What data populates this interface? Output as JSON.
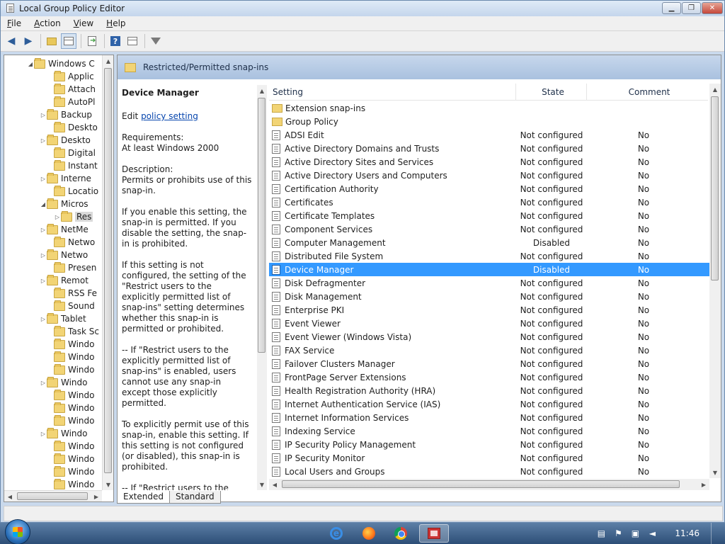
{
  "window": {
    "title": "Local Group Policy Editor",
    "minimize": "▁",
    "maximize": "❐",
    "close": "✕"
  },
  "menu": [
    {
      "key": "F",
      "rest": "ile"
    },
    {
      "key": "A",
      "rest": "ction"
    },
    {
      "key": "V",
      "rest": "iew"
    },
    {
      "key": "H",
      "rest": "elp"
    }
  ],
  "toolbar": {
    "back": "◀",
    "forward": "▶",
    "help": "?"
  },
  "tree": {
    "items": [
      {
        "label": "Windows C",
        "arrow": "◢",
        "indent": 46
      },
      {
        "label": "Applic",
        "arrow": "",
        "indent": 74
      },
      {
        "label": "Attach",
        "arrow": "",
        "indent": 74
      },
      {
        "label": "AutoPl",
        "arrow": "",
        "indent": 74
      },
      {
        "label": "Backup",
        "arrow": "▷",
        "indent": 64
      },
      {
        "label": "Deskto",
        "arrow": "",
        "indent": 74
      },
      {
        "label": "Deskto",
        "arrow": "▷",
        "indent": 64
      },
      {
        "label": "Digital",
        "arrow": "",
        "indent": 74
      },
      {
        "label": "Instant",
        "arrow": "",
        "indent": 74
      },
      {
        "label": "Interne",
        "arrow": "▷",
        "indent": 64
      },
      {
        "label": "Locatio",
        "arrow": "",
        "indent": 74
      },
      {
        "label": "Micros",
        "arrow": "◢",
        "indent": 64
      },
      {
        "label": "Res",
        "arrow": "▷",
        "indent": 84,
        "selected": true
      },
      {
        "label": "NetMe",
        "arrow": "▷",
        "indent": 64
      },
      {
        "label": "Netwo",
        "arrow": "",
        "indent": 74
      },
      {
        "label": "Netwo",
        "arrow": "▷",
        "indent": 64
      },
      {
        "label": "Presen",
        "arrow": "",
        "indent": 74
      },
      {
        "label": "Remot",
        "arrow": "▷",
        "indent": 64
      },
      {
        "label": "RSS Fe",
        "arrow": "",
        "indent": 74
      },
      {
        "label": "Sound",
        "arrow": "",
        "indent": 74
      },
      {
        "label": "Tablet",
        "arrow": "▷",
        "indent": 64
      },
      {
        "label": "Task Sc",
        "arrow": "",
        "indent": 74
      },
      {
        "label": "Windo",
        "arrow": "",
        "indent": 74
      },
      {
        "label": "Windo",
        "arrow": "",
        "indent": 74
      },
      {
        "label": "Windo",
        "arrow": "",
        "indent": 74
      },
      {
        "label": "Windo",
        "arrow": "▷",
        "indent": 64
      },
      {
        "label": "Windo",
        "arrow": "",
        "indent": 74
      },
      {
        "label": "Windo",
        "arrow": "",
        "indent": 74
      },
      {
        "label": "Windo",
        "arrow": "",
        "indent": 74
      },
      {
        "label": "Windo",
        "arrow": "▷",
        "indent": 64
      },
      {
        "label": "Windo",
        "arrow": "",
        "indent": 74
      },
      {
        "label": "Windo",
        "arrow": "",
        "indent": 74
      },
      {
        "label": "Windo",
        "arrow": "",
        "indent": 74
      },
      {
        "label": "Windo",
        "arrow": "",
        "indent": 74
      }
    ]
  },
  "header": {
    "title": "Restricted/Permitted snap-ins"
  },
  "description": {
    "title": "Device Manager",
    "edit_prefix": "Edit ",
    "edit_link": "policy setting",
    "requirements_label": "Requirements:",
    "requirements_value": "At least Windows 2000",
    "description_label": "Description:",
    "paragraphs": [
      "Permits or prohibits use of this snap-in.",
      "If you enable this setting, the snap-in is permitted. If you disable the setting, the snap-in is prohibited.",
      "If this setting is not configured, the setting of the \"Restrict users to the explicitly permitted list of snap-ins\" setting determines whether this snap-in is permitted or prohibited.",
      "-- If \"Restrict users to the explicitly permitted list of snap-ins\" is enabled, users cannot use any snap-in except those explicitly permitted.",
      "To explicitly permit use of this snap-in, enable this setting. If this setting is not configured (or disabled), this snap-in is prohibited.",
      "-- If \"Restrict users to the explicitly permitted list of snap-ins\" is disabled or not configured, users can use any snap-in except"
    ]
  },
  "list": {
    "columns": {
      "setting": "Setting",
      "state": "State",
      "comment": "Comment"
    },
    "rows": [
      {
        "type": "folder",
        "setting": "Extension snap-ins",
        "state": "",
        "comment": ""
      },
      {
        "type": "folder",
        "setting": "Group Policy",
        "state": "",
        "comment": ""
      },
      {
        "type": "policy",
        "setting": "ADSI Edit",
        "state": "Not configured",
        "comment": "No"
      },
      {
        "type": "policy",
        "setting": "Active Directory Domains and Trusts",
        "state": "Not configured",
        "comment": "No"
      },
      {
        "type": "policy",
        "setting": "Active Directory Sites and Services",
        "state": "Not configured",
        "comment": "No"
      },
      {
        "type": "policy",
        "setting": "Active Directory Users and Computers",
        "state": "Not configured",
        "comment": "No"
      },
      {
        "type": "policy",
        "setting": "Certification Authority",
        "state": "Not configured",
        "comment": "No"
      },
      {
        "type": "policy",
        "setting": "Certificates",
        "state": "Not configured",
        "comment": "No"
      },
      {
        "type": "policy",
        "setting": "Certificate Templates",
        "state": "Not configured",
        "comment": "No"
      },
      {
        "type": "policy",
        "setting": "Component Services",
        "state": "Not configured",
        "comment": "No"
      },
      {
        "type": "policy",
        "setting": "Computer Management",
        "state": "Disabled",
        "comment": "No"
      },
      {
        "type": "policy",
        "setting": "Distributed File System",
        "state": "Not configured",
        "comment": "No"
      },
      {
        "type": "policy",
        "setting": "Device Manager",
        "state": "Disabled",
        "comment": "No",
        "selected": true
      },
      {
        "type": "policy",
        "setting": "Disk Defragmenter",
        "state": "Not configured",
        "comment": "No"
      },
      {
        "type": "policy",
        "setting": "Disk Management",
        "state": "Not configured",
        "comment": "No"
      },
      {
        "type": "policy",
        "setting": "Enterprise PKI",
        "state": "Not configured",
        "comment": "No"
      },
      {
        "type": "policy",
        "setting": "Event Viewer",
        "state": "Not configured",
        "comment": "No"
      },
      {
        "type": "policy",
        "setting": "Event Viewer (Windows Vista)",
        "state": "Not configured",
        "comment": "No"
      },
      {
        "type": "policy",
        "setting": "FAX Service",
        "state": "Not configured",
        "comment": "No"
      },
      {
        "type": "policy",
        "setting": "Failover Clusters Manager",
        "state": "Not configured",
        "comment": "No"
      },
      {
        "type": "policy",
        "setting": "FrontPage Server Extensions",
        "state": "Not configured",
        "comment": "No"
      },
      {
        "type": "policy",
        "setting": "Health Registration Authority (HRA)",
        "state": "Not configured",
        "comment": "No"
      },
      {
        "type": "policy",
        "setting": "Internet Authentication Service (IAS)",
        "state": "Not configured",
        "comment": "No"
      },
      {
        "type": "policy",
        "setting": "Internet Information Services",
        "state": "Not configured",
        "comment": "No"
      },
      {
        "type": "policy",
        "setting": "Indexing Service",
        "state": "Not configured",
        "comment": "No"
      },
      {
        "type": "policy",
        "setting": "IP Security Policy Management",
        "state": "Not configured",
        "comment": "No"
      },
      {
        "type": "policy",
        "setting": "IP Security Monitor",
        "state": "Not configured",
        "comment": "No"
      },
      {
        "type": "policy",
        "setting": "Local Users and Groups",
        "state": "Not configured",
        "comment": "No"
      }
    ]
  },
  "tabs": [
    {
      "label": "Extended",
      "active": true
    },
    {
      "label": "Standard",
      "active": false
    }
  ],
  "taskbar": {
    "clock": "11:46"
  }
}
